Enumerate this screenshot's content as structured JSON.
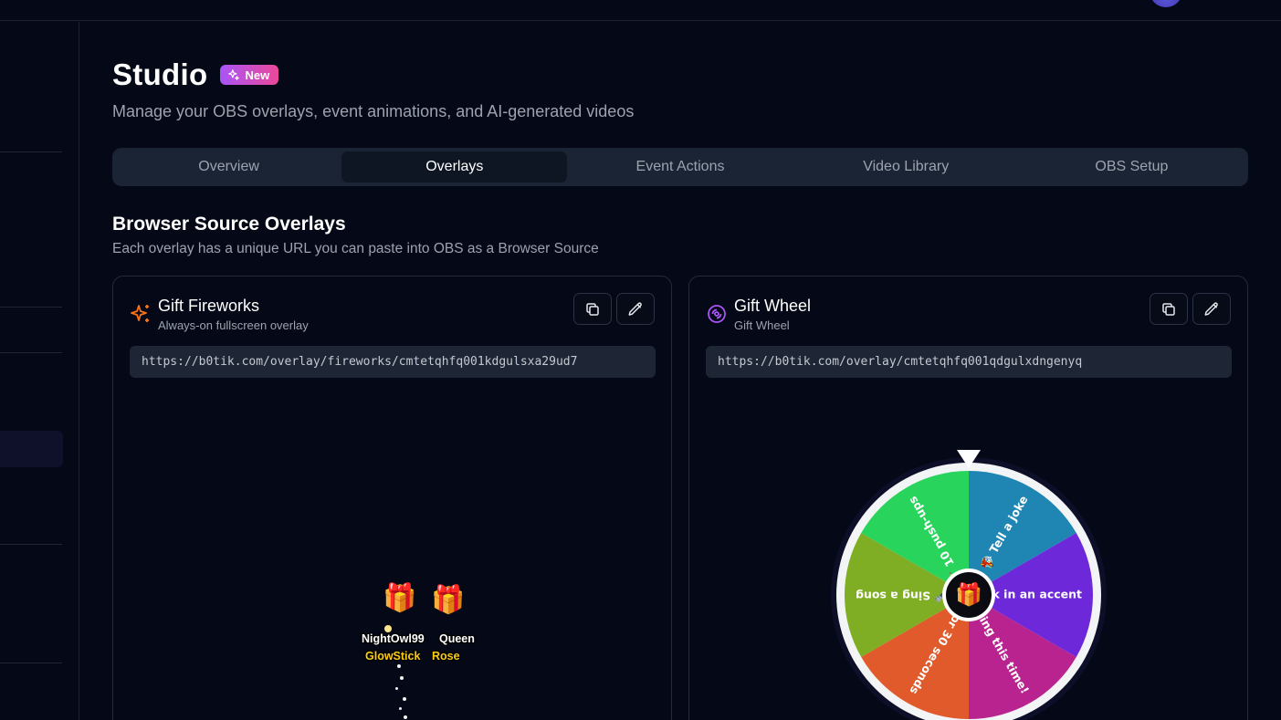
{
  "header": {
    "avatar": "avatar"
  },
  "page": {
    "title": "Studio",
    "badge": "New",
    "subtitle": "Manage your OBS overlays, event animations, and AI-generated videos"
  },
  "tabs": [
    {
      "label": "Overview",
      "active": false
    },
    {
      "label": "Overlays",
      "active": true
    },
    {
      "label": "Event Actions",
      "active": false
    },
    {
      "label": "Video Library",
      "active": false
    },
    {
      "label": "OBS Setup",
      "active": false
    }
  ],
  "section": {
    "title": "Browser Source Overlays",
    "description": "Each overlay has a unique URL you can paste into OBS as a Browser Source"
  },
  "cards": [
    {
      "title": "Gift Fireworks",
      "subtitle": "Always-on fullscreen overlay",
      "url": "https://b0tik.com/overlay/fireworks/cmtetqhfq001kdgulsxa29ud7",
      "icon": "sparkles-icon",
      "preview": {
        "gifts": [
          {
            "user": "NightOwl99",
            "item": "GlowStick",
            "emoji": "🎁"
          },
          {
            "user": "Queen",
            "item": "Rose",
            "emoji": "🎁"
          }
        ]
      }
    },
    {
      "title": "Gift Wheel",
      "subtitle": "Gift Wheel",
      "url": "https://b0tik.com/overlay/cmtetqhfq001qdgulxdngenyq",
      "icon": "disc-icon",
      "wheel": {
        "center": "🎁",
        "segments": [
          {
            "label": "Tell a joke",
            "emoji": "😂",
            "color": "#1f86b3"
          },
          {
            "label": "Speak in an accent",
            "emoji": "🗣️",
            "color": "#6d28d9"
          },
          {
            "label": "Nothing this time!",
            "emoji": "🎁",
            "color": "#b8238f"
          },
          {
            "label": "Dance for 30 seconds",
            "emoji": "💃",
            "color": "#e05a2b"
          },
          {
            "label": "Sing a song",
            "emoji": "🎤",
            "color": "#7fad23"
          },
          {
            "label": "10 push-ups",
            "emoji": "🏋️",
            "color": "#29d45c"
          }
        ]
      }
    }
  ],
  "colors": {
    "background": "#050816",
    "accent_gradient_start": "#a855f7",
    "accent_gradient_end": "#ec4899",
    "fireworks_icon": "#f97316",
    "wheel_icon": "#a855f7"
  }
}
